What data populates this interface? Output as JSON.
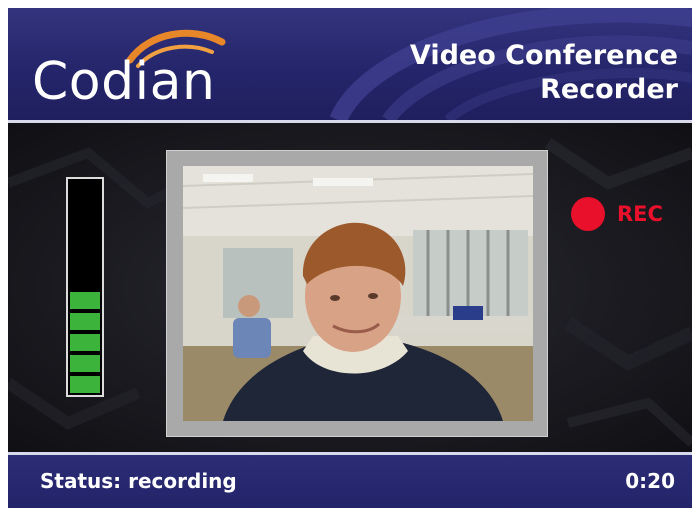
{
  "header": {
    "logo_text": "Codian",
    "title_line1": "Video Conference",
    "title_line2": "Recorder"
  },
  "audio_meter": {
    "level_fraction": 0.5,
    "segment_count": 5,
    "colors": {
      "active": "#3cb33a",
      "background": "#000000"
    }
  },
  "video": {
    "description_icon": "camera-feed"
  },
  "recording": {
    "label": "REC",
    "color": "#e8102a"
  },
  "status": {
    "text": "Status: recording",
    "elapsed": "0:20"
  },
  "colors": {
    "header": "#2a2a72",
    "accent_orange": "#e8862a",
    "text": "#ffffff"
  }
}
